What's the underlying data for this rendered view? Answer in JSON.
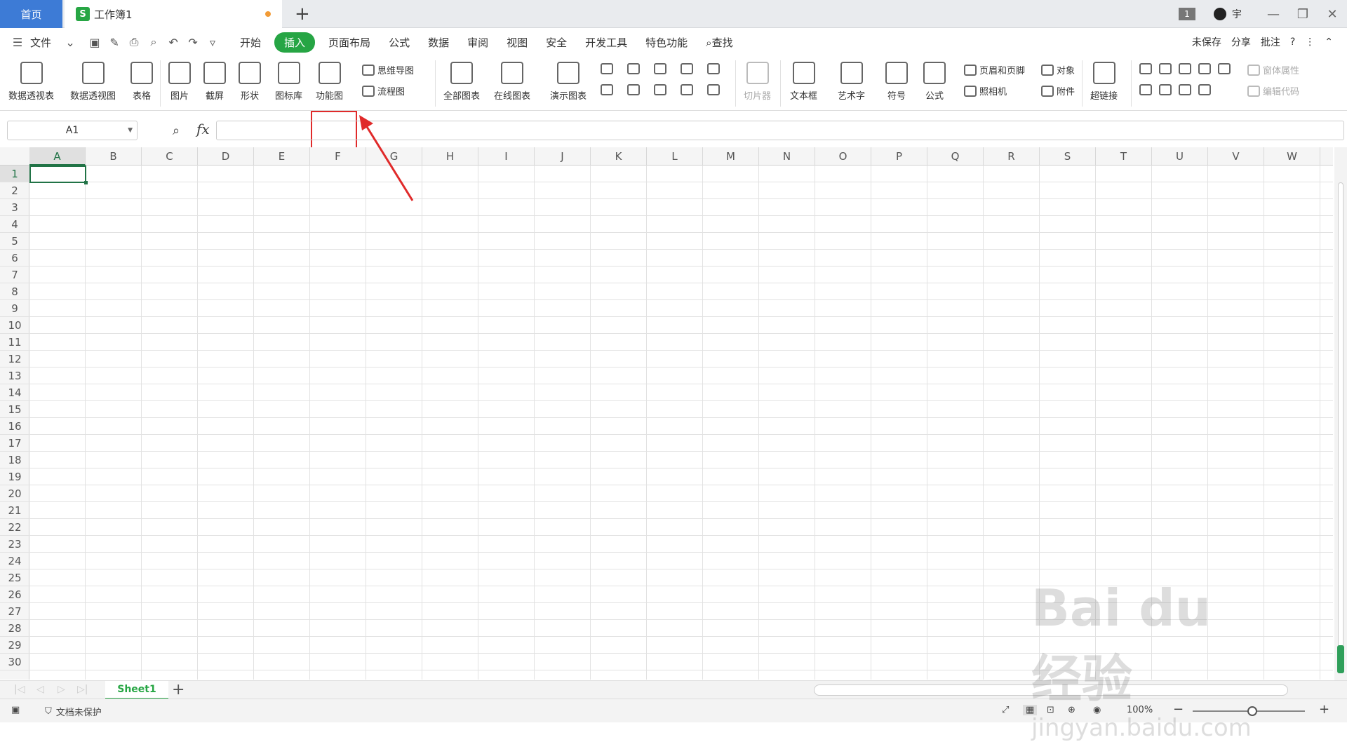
{
  "tabs": {
    "home": "首页",
    "doc": "工作簿1",
    "doc_icon": "S",
    "add": "+"
  },
  "titlebar": {
    "badge": "1",
    "user": "宇",
    "minimize": "—",
    "restore": "❐",
    "close": "✕"
  },
  "menu": {
    "file": "文件",
    "items": [
      "开始",
      "插入",
      "页面布局",
      "公式",
      "数据",
      "审阅",
      "视图",
      "安全",
      "开发工具",
      "特色功能"
    ],
    "active_index": 1,
    "search": "查找",
    "right": [
      "未保存",
      "分享",
      "批注"
    ]
  },
  "ribbon": {
    "pivot_table": "数据透视表",
    "pivot_chart": "数据透视图",
    "table": "表格",
    "picture": "图片",
    "screenshot": "截屏",
    "shape": "形状",
    "icon_lib": "图标库",
    "function_chart": "功能图",
    "mind_map": "思维导图",
    "flowchart": "流程图",
    "all_charts": "全部图表",
    "online_charts": "在线图表",
    "demo_charts": "演示图表",
    "slicer": "切片器",
    "text_box": "文本框",
    "word_art": "艺术字",
    "symbol": "符号",
    "formula": "公式",
    "header_footer": "页眉和页脚",
    "object": "对象",
    "camera": "照相机",
    "attachment": "附件",
    "hyperlink": "超链接",
    "form_props": "窗体属性",
    "edit_code": "编辑代码"
  },
  "formula_bar": {
    "cell_ref": "A1",
    "fx": "fx",
    "value": ""
  },
  "grid": {
    "columns": [
      "A",
      "B",
      "C",
      "D",
      "E",
      "F",
      "G",
      "H",
      "I",
      "J",
      "K",
      "L",
      "M",
      "N",
      "O",
      "P",
      "Q",
      "R",
      "S",
      "T",
      "U",
      "V",
      "W"
    ],
    "rows": [
      "1",
      "2",
      "3",
      "4",
      "5",
      "6",
      "7",
      "8",
      "9",
      "10",
      "11",
      "12",
      "13",
      "14",
      "15",
      "16",
      "17",
      "18",
      "19",
      "20",
      "21",
      "22",
      "23",
      "24",
      "25",
      "26",
      "27",
      "28",
      "29",
      "30"
    ],
    "selected_cell": "A1"
  },
  "sheets": {
    "active": "Sheet1",
    "add": "+"
  },
  "status": {
    "protect": "文档未保护",
    "zoom": "100%"
  },
  "watermark": {
    "main": "Bai du 经验",
    "sub": "jingyan.baidu.com"
  },
  "colors": {
    "accent": "#26a544",
    "highlight": "#e02a2a",
    "home_tab": "#3d7bd6"
  }
}
